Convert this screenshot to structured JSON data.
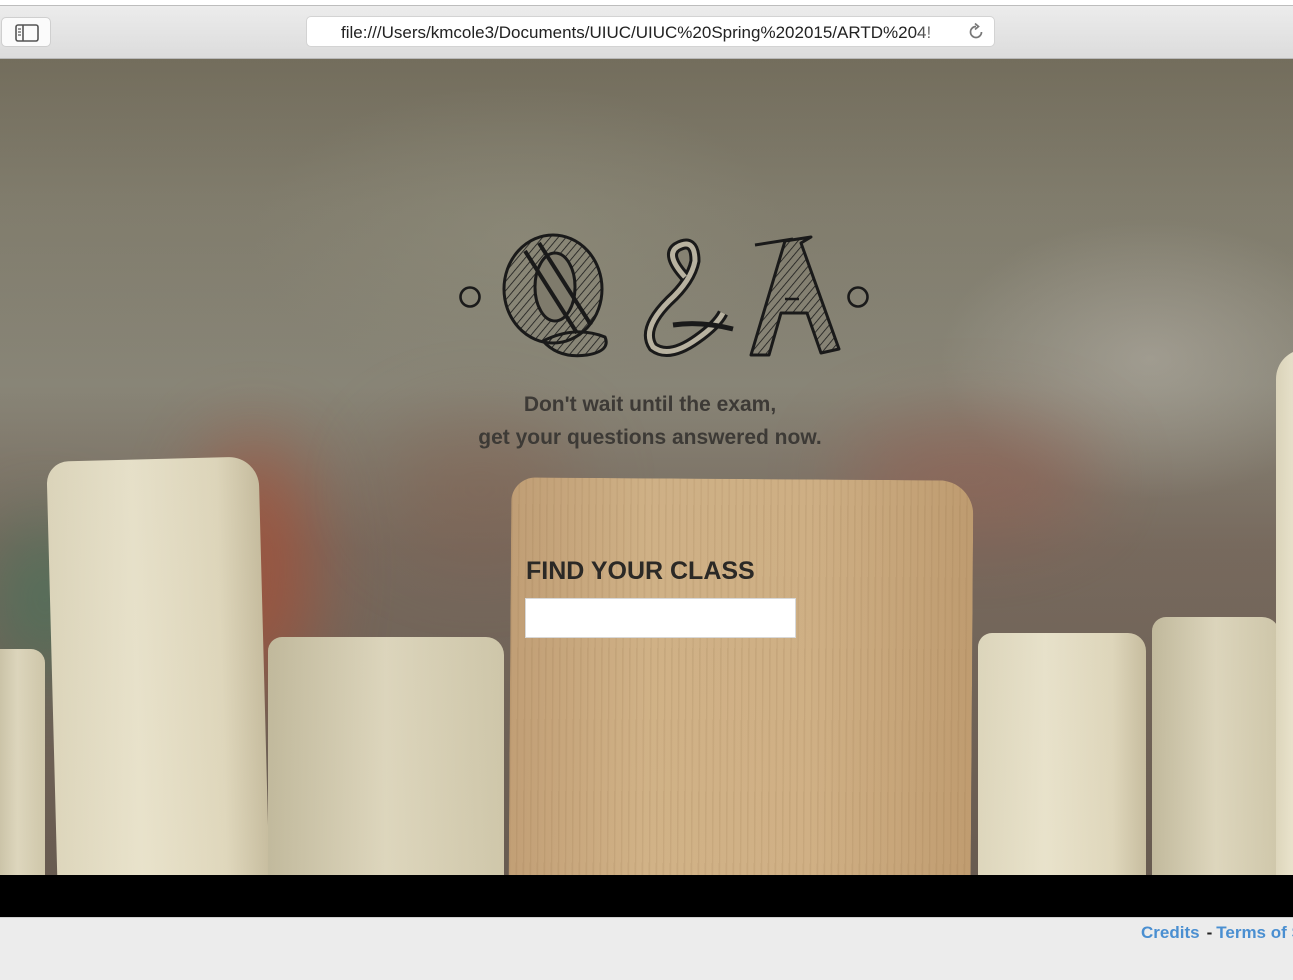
{
  "browser": {
    "url": "file:///Users/kmcole3/Documents/UIUC/UIUC%20Spring%202015/ARTD%204!"
  },
  "hero": {
    "logo_text": "Q&A",
    "tagline_line1": "Don't wait until the exam,",
    "tagline_line2": "get your questions answered now.",
    "find_label": "FIND YOUR CLASS",
    "search_value": ""
  },
  "footer": {
    "credits": "Credits",
    "separator": "-",
    "terms": "Terms of S"
  }
}
